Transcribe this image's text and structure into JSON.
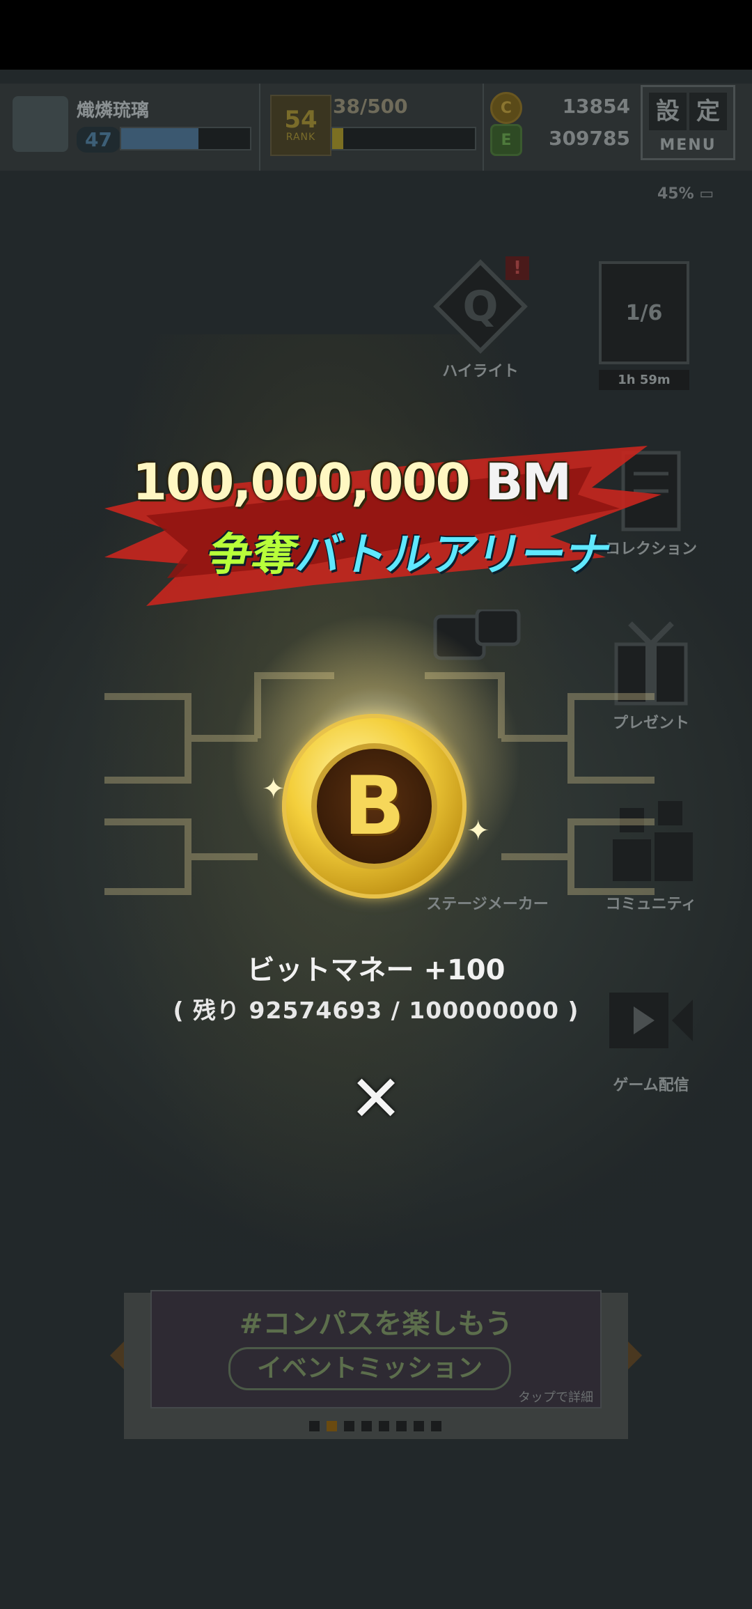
{
  "hud": {
    "player_name": "熾燐琉璃",
    "level": "47",
    "exp_progress": 0.6,
    "rank": "54",
    "rank_label": "RANK",
    "stamina": "38/500",
    "stamina_progress": 0.076,
    "currency_gold": "13854",
    "currency_green": "309785",
    "menu_kanji_1": "設",
    "menu_kanji_2": "定",
    "menu_label": "MENU",
    "battery": "45%"
  },
  "side_menu": {
    "highlight": "ハイライト",
    "timer": "1h 59m",
    "page_counter": "1/6",
    "collection": "コレクション",
    "present": "プレゼント",
    "stage_maker": "ステージメーカー",
    "community": "コミュニティ",
    "game_stream": "ゲーム配信"
  },
  "popup": {
    "title_amount": "100,000,000",
    "title_unit": "BM",
    "title_line2_a": "争奪",
    "title_line2_b": "バトルアリーナ",
    "coin_letter": "B",
    "reward": "ビットマネー +100",
    "remaining": "( 残り 92574693 / 100000000 )",
    "close_icon": "close-icon"
  },
  "banner": {
    "title": "#コンパスを楽しもう",
    "subtitle": "イベントミッション",
    "tap_hint": "タップで詳細",
    "active_dot": 1,
    "dot_count": 8
  },
  "colors": {
    "accent_gold": "#f4cf3c",
    "title_cyan": "#5fe8ff",
    "title_green": "#b8ff3a",
    "ribbon_red": "#c8261e"
  }
}
